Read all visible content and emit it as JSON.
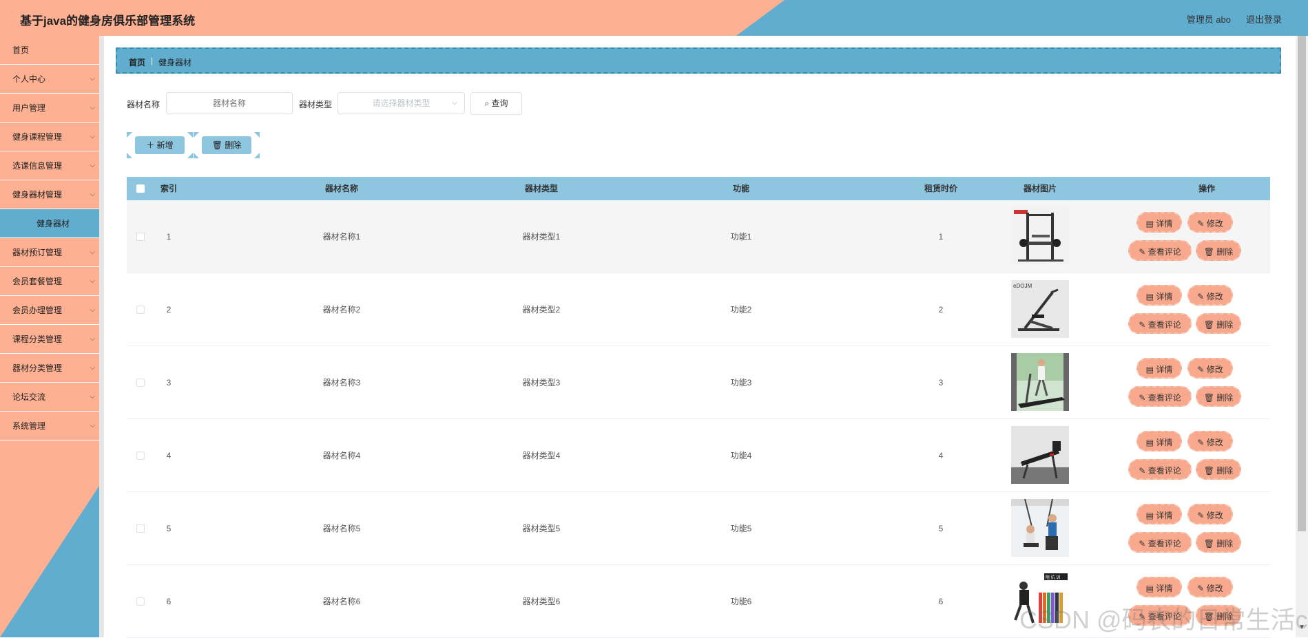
{
  "header": {
    "title": "基于java的健身房俱乐部管理系统",
    "user": "管理员 abo",
    "logout": "退出登录"
  },
  "sidebar": {
    "items": [
      {
        "label": "首页",
        "chevron": false
      },
      {
        "label": "个人中心",
        "chevron": true
      },
      {
        "label": "用户管理",
        "chevron": true
      },
      {
        "label": "健身课程管理",
        "chevron": true
      },
      {
        "label": "选课信息管理",
        "chevron": true
      },
      {
        "label": "健身器材管理",
        "chevron": true
      },
      {
        "label": "健身器材",
        "sub": true
      },
      {
        "label": "器材预订管理",
        "chevron": true
      },
      {
        "label": "会员套餐管理",
        "chevron": true
      },
      {
        "label": "会员办理管理",
        "chevron": true
      },
      {
        "label": "课程分类管理",
        "chevron": true
      },
      {
        "label": "器材分类管理",
        "chevron": true
      },
      {
        "label": "论坛交流",
        "chevron": true
      },
      {
        "label": "系统管理",
        "chevron": true
      }
    ]
  },
  "breadcrumb": {
    "home": "首页",
    "current": "健身器材"
  },
  "search": {
    "name_label": "器材名称",
    "name_placeholder": "器材名称",
    "type_label": "器材类型",
    "type_placeholder": "请选择器材类型",
    "query_label": "查询"
  },
  "actions": {
    "add": "新增",
    "delete": "删除"
  },
  "table": {
    "columns": [
      "索引",
      "器材名称",
      "器材类型",
      "功能",
      "租赁时价",
      "器材图片",
      "操作"
    ],
    "ops": {
      "detail": "详情",
      "edit": "修改",
      "comments": "查看评论",
      "delete": "删除"
    },
    "rows": [
      {
        "index": "1",
        "name": "器材名称1",
        "type": "器材类型1",
        "func": "功能1",
        "price": "1"
      },
      {
        "index": "2",
        "name": "器材名称2",
        "type": "器材类型2",
        "func": "功能2",
        "price": "2"
      },
      {
        "index": "3",
        "name": "器材名称3",
        "type": "器材类型3",
        "func": "功能3",
        "price": "3"
      },
      {
        "index": "4",
        "name": "器材名称4",
        "type": "器材类型4",
        "func": "功能4",
        "price": "4"
      },
      {
        "index": "5",
        "name": "器材名称5",
        "type": "器材类型5",
        "func": "功能5",
        "price": "5"
      },
      {
        "index": "6",
        "name": "器材名称6",
        "type": "器材类型6",
        "func": "功能6",
        "price": "6"
      }
    ]
  },
  "watermark": "CSDN @码农的日常生活c",
  "colors": {
    "orange": "#fdb092",
    "blue": "#60adcf",
    "light_blue": "#8ec5df",
    "button_orange": "#f8a98d"
  }
}
